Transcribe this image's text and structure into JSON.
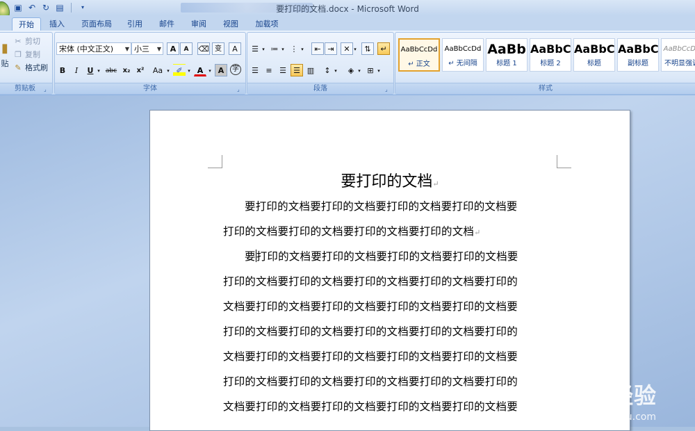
{
  "window": {
    "title": "要打印的文档.docx - Microsoft Word"
  },
  "quick_access": {
    "icons": [
      "save-icon",
      "undo-icon",
      "redo-icon",
      "new-doc-icon"
    ]
  },
  "tabs": [
    {
      "label": "开始"
    },
    {
      "label": "插入"
    },
    {
      "label": "页面布局"
    },
    {
      "label": "引用"
    },
    {
      "label": "邮件"
    },
    {
      "label": "审阅"
    },
    {
      "label": "视图"
    },
    {
      "label": "加载项"
    }
  ],
  "clipboard": {
    "label": "剪贴板",
    "paste_label": "贴",
    "cut_label": "剪切",
    "copy_label": "复制",
    "format_painter_label": "格式刷"
  },
  "font": {
    "label": "字体",
    "font_name": "宋体 (中文正文)",
    "font_size": "小三",
    "buttons": {
      "grow": "A",
      "shrink": "A",
      "bold": "B",
      "italic": "I",
      "underline": "U",
      "strikethrough": "abc",
      "subscript": "x₂",
      "superscript": "x²",
      "change_case": "Aa",
      "font_color": "A",
      "char_shading": "A",
      "enclose": "字"
    },
    "phonetic": "文",
    "char_border": "A",
    "wen": "变"
  },
  "paragraph": {
    "label": "段落"
  },
  "styles": {
    "label": "样式",
    "items": [
      {
        "sample": "AaBbCcDd",
        "name": "↵ 正文",
        "active": true
      },
      {
        "sample": "AaBbCcDd",
        "name": "↵ 无间隔"
      },
      {
        "sample": "AaBb",
        "name": "标题 1"
      },
      {
        "sample": "AaBbC",
        "name": "标题 2"
      },
      {
        "sample": "AaBbC",
        "name": "标题"
      },
      {
        "sample": "AaBbC",
        "name": "副标题"
      },
      {
        "sample": "AaBbCcDd",
        "name": "不明显强调"
      }
    ]
  },
  "document": {
    "title": "要打印的文档",
    "para1_line1": "要打印的文档要打印的文档要打印的文档要打印的文档要",
    "para1_line2": "打印的文档要打印的文档要打印的文档要打印的文档",
    "para2_first_char": "要",
    "para2_line1_rest": "打印的文档要打印的文档要打印的文档要打印的文档要",
    "para2_lines": [
      "打印的文档要打印的文档要打印的文档要打印的文档要打印的",
      "文档要打印的文档要打印的文档要打印的文档要打印的文档要",
      "打印的文档要打印的文档要打印的文档要打印的文档要打印的",
      "文档要打印的文档要打印的文档要打印的文档要打印的文档要",
      "打印的文档要打印的文档要打印的文档要打印的文档要打印的",
      "文档要打印的文档要打印的文档要打印的文档要打印的文档要"
    ],
    "paragraph_mark": "↵"
  },
  "watermark": {
    "text": "Baidu 经验",
    "sub": "jingyan.baidu.com"
  }
}
